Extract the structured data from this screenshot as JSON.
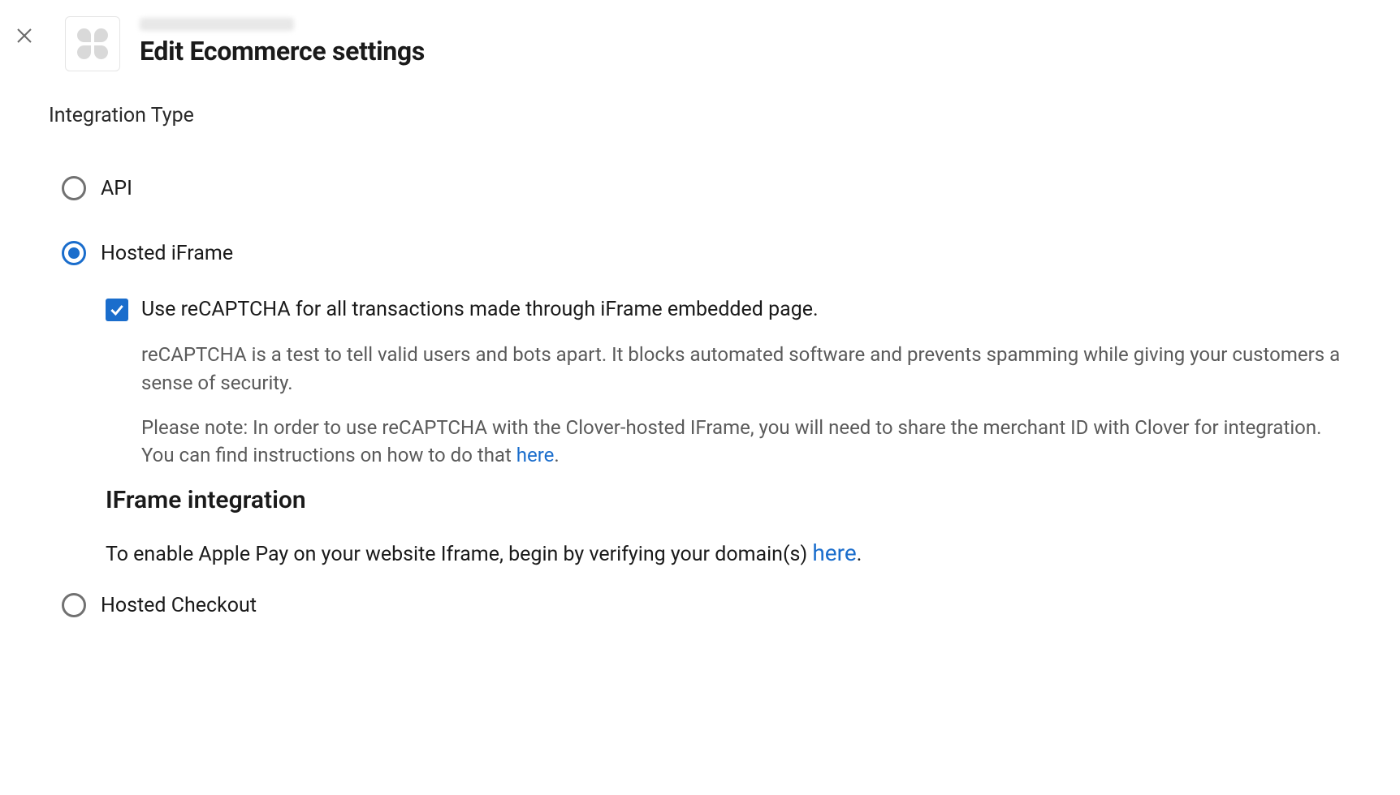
{
  "header": {
    "title": "Edit Ecommerce settings"
  },
  "section": {
    "label": "Integration Type"
  },
  "options": {
    "api": {
      "label": "API",
      "selected": false
    },
    "hosted_iframe": {
      "label": "Hosted iFrame",
      "selected": true
    },
    "hosted_checkout": {
      "label": "Hosted Checkout",
      "selected": false
    }
  },
  "recaptcha": {
    "checked": true,
    "label": "Use reCAPTCHA for all transactions made through iFrame embedded page.",
    "desc1": "reCAPTCHA is a test to tell valid users and bots apart. It blocks automated software and prevents spamming while giving your customers a sense of security.",
    "desc2_prefix": "Please note: In order to use reCAPTCHA with the Clover-hosted IFrame, you will need to share the merchant ID with Clover for integration. You can find instructions on how to do that ",
    "desc2_link": "here",
    "desc2_suffix": "."
  },
  "iframe_section": {
    "heading": "IFrame integration",
    "desc_prefix": "To enable Apple Pay on your website Iframe, begin by verifying your domain(s) ",
    "desc_link": "here",
    "desc_suffix": "."
  }
}
